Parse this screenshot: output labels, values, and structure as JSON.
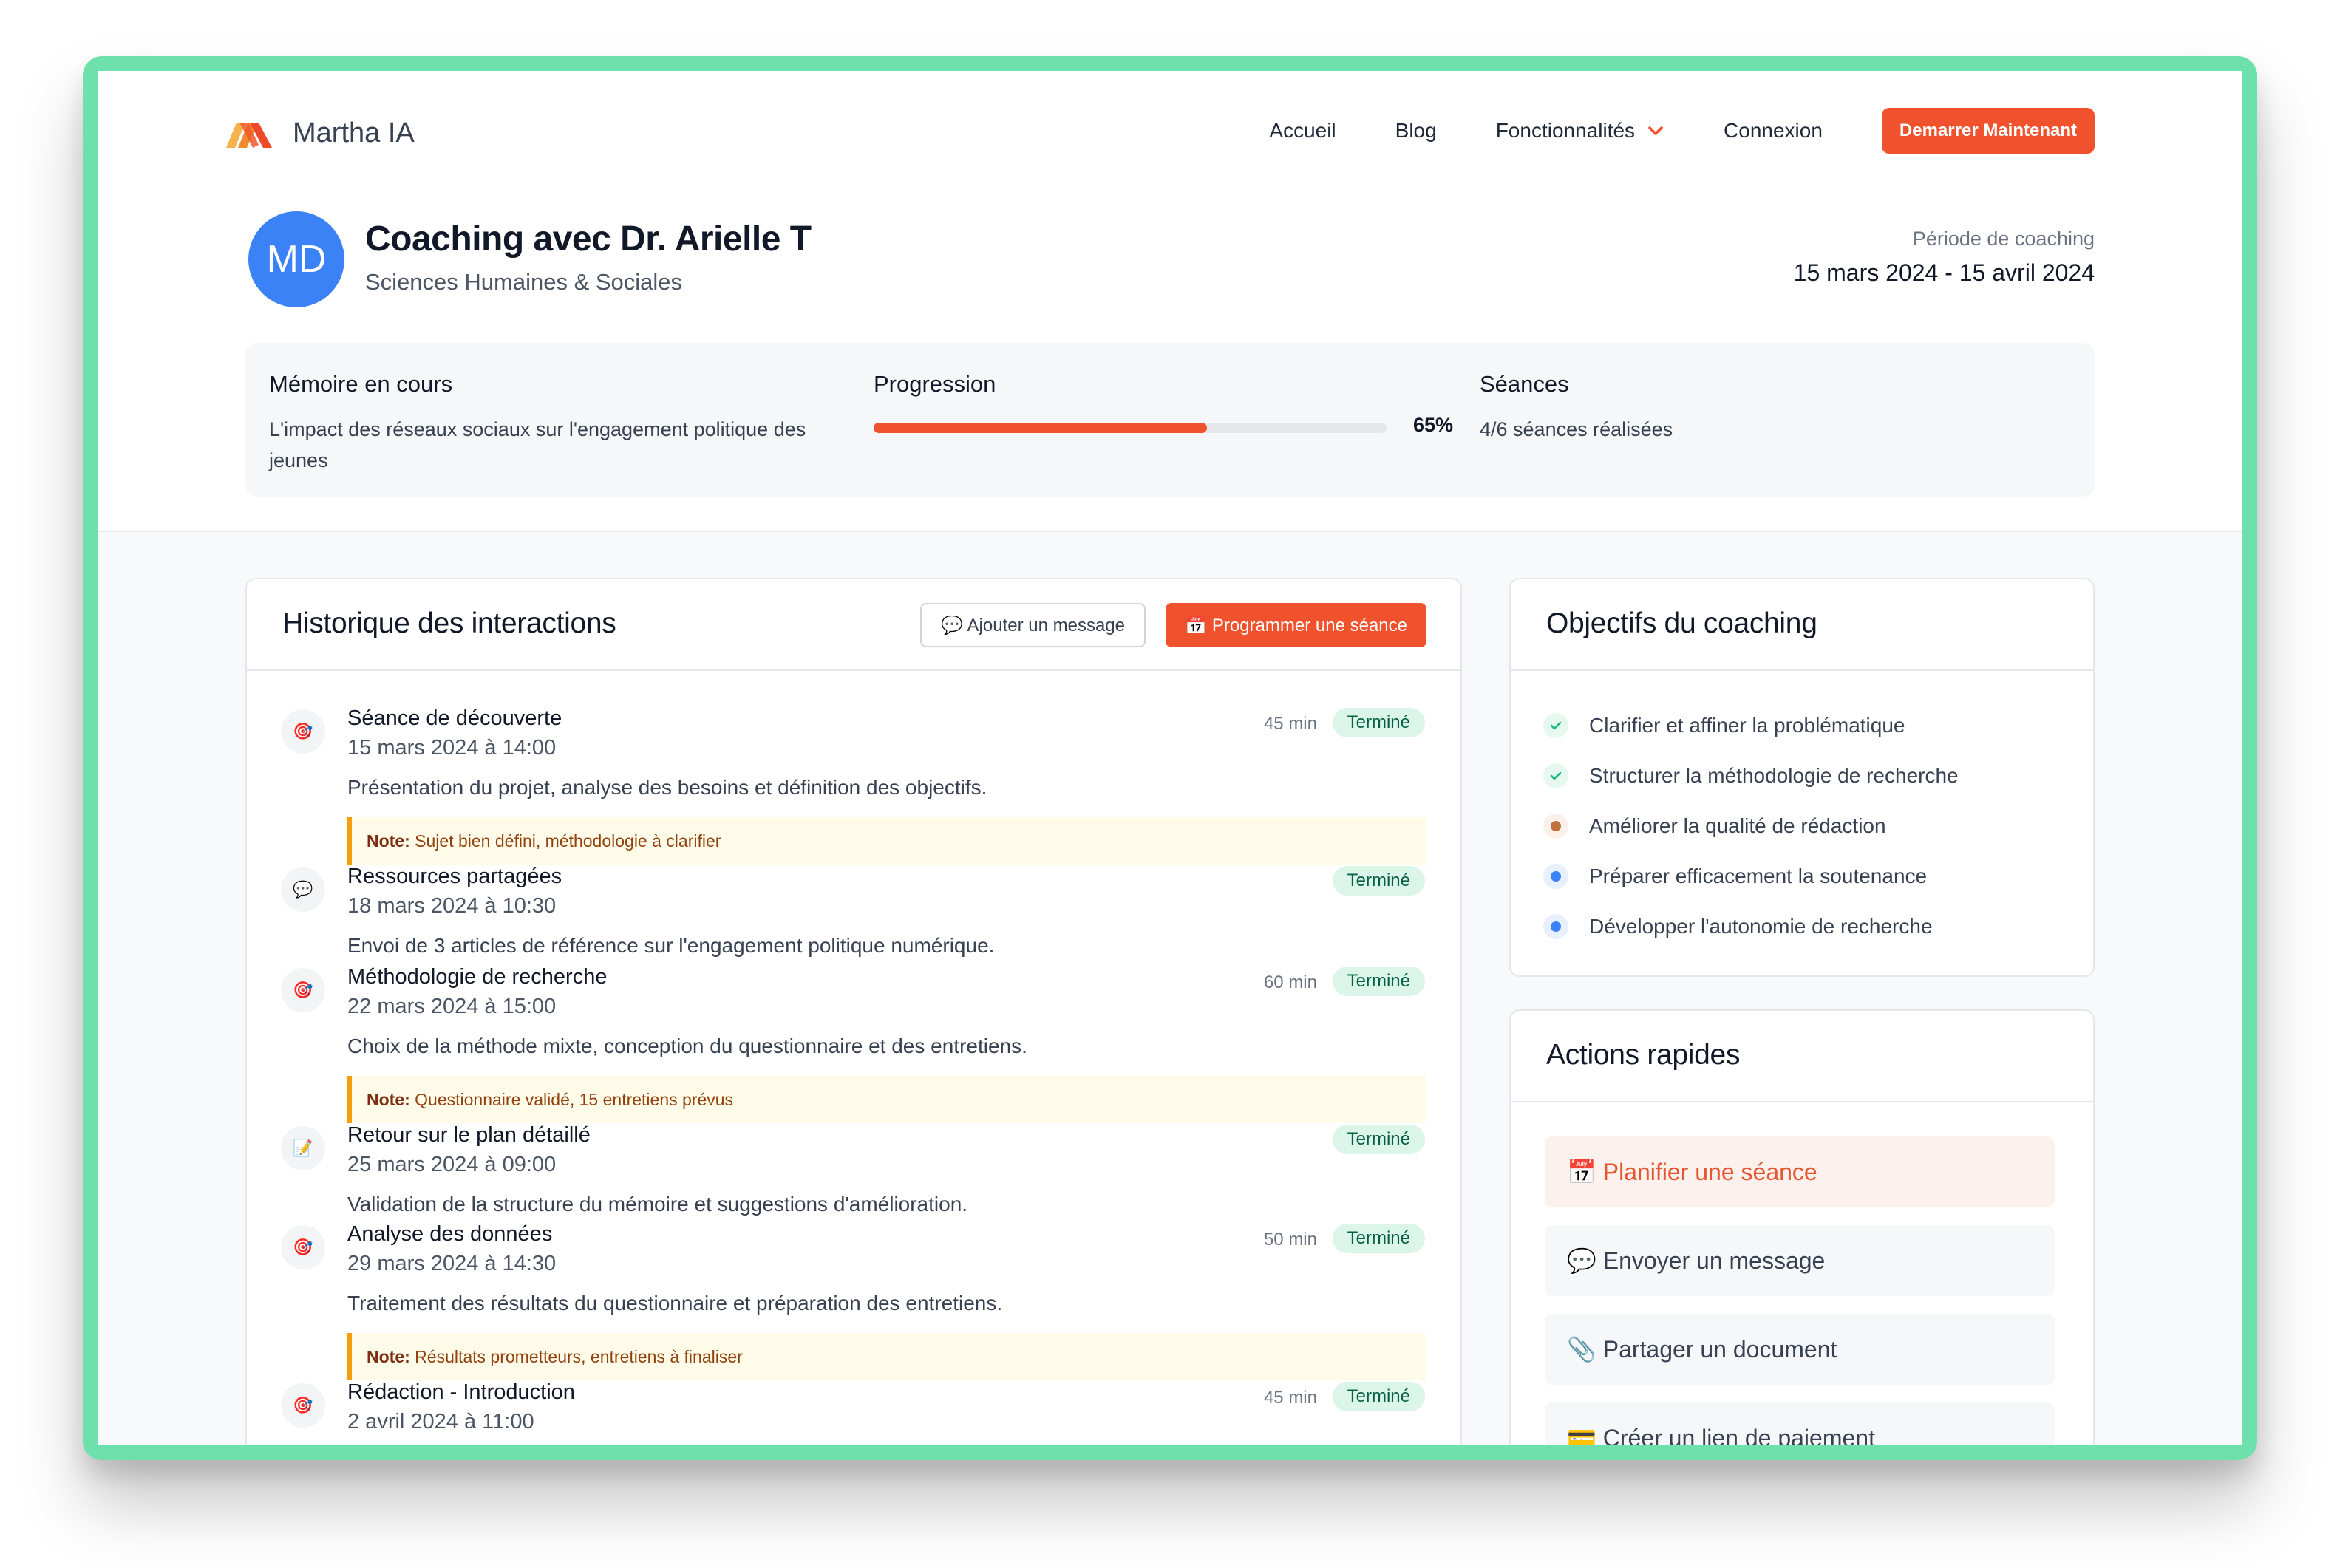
{
  "nav": {
    "brand": "Martha IA",
    "links": [
      "Accueil",
      "Blog",
      "Fonctionnalités",
      "Connexion"
    ],
    "cta": "Demarrer Maintenant"
  },
  "coach": {
    "initials": "MD",
    "title": "Coaching avec Dr. Arielle T",
    "subtitle": "Sciences Humaines & Sociales",
    "period_label": "Période de coaching",
    "period_value": "15 mars 2024 - 15 avril 2024"
  },
  "summary": {
    "thesis_title": "Mémoire en cours",
    "thesis_text": "L'impact des réseaux sociaux sur l'engagement politique des jeunes",
    "progress_title": "Progression",
    "progress_value": 0.65,
    "progress_label": "65%",
    "sessions_title": "Séances",
    "sessions_text": "4/6 séances réalisées"
  },
  "history": {
    "title": "Historique des interactions",
    "add_message": "💬 Ajouter un message",
    "schedule": "📅 Programmer une séance",
    "note_label": "Note:",
    "entries": [
      {
        "icon": "🎯",
        "title": "Séance de découverte",
        "date": "15 mars 2024 à 14:00",
        "duration": "45 min",
        "status": "Terminé",
        "desc": "Présentation du projet, analyse des besoins et définition des objectifs.",
        "note": "Sujet bien défini, méthodologie à clarifier"
      },
      {
        "icon": "💬",
        "title": "Ressources partagées",
        "date": "18 mars 2024 à 10:30",
        "duration": "",
        "status": "Terminé",
        "desc": "Envoi de 3 articles de référence sur l'engagement politique numérique.",
        "note": ""
      },
      {
        "icon": "🎯",
        "title": "Méthodologie de recherche",
        "date": "22 mars 2024 à 15:00",
        "duration": "60 min",
        "status": "Terminé",
        "desc": "Choix de la méthode mixte, conception du questionnaire et des entretiens.",
        "note": "Questionnaire validé, 15 entretiens prévus"
      },
      {
        "icon": "📝",
        "title": "Retour sur le plan détaillé",
        "date": "25 mars 2024 à 09:00",
        "duration": "",
        "status": "Terminé",
        "desc": "Validation de la structure du mémoire et suggestions d'amélioration.",
        "note": ""
      },
      {
        "icon": "🎯",
        "title": "Analyse des données",
        "date": "29 mars 2024 à 14:30",
        "duration": "50 min",
        "status": "Terminé",
        "desc": "Traitement des résultats du questionnaire et préparation des entretiens.",
        "note": "Résultats prometteurs, entretiens à finaliser"
      },
      {
        "icon": "🎯",
        "title": "Rédaction - Introduction",
        "date": "2 avril 2024 à 11:00",
        "duration": "45 min",
        "status": "Terminé",
        "desc": "",
        "note": ""
      }
    ]
  },
  "objectives": {
    "title": "Objectifs du coaching",
    "items": [
      {
        "text": "Clarifier et affiner la problématique",
        "state": "done"
      },
      {
        "text": "Structurer la méthodologie de recherche",
        "state": "done"
      },
      {
        "text": "Améliorer la qualité de rédaction",
        "state": "in-progress"
      },
      {
        "text": "Préparer efficacement la soutenance",
        "state": "todo"
      },
      {
        "text": "Développer l'autonomie de recherche",
        "state": "todo"
      }
    ],
    "colors": {
      "done": "#10b981",
      "in-progress": "#c2703d",
      "todo": "#3b82f6"
    }
  },
  "quick_actions": {
    "title": "Actions rapides",
    "items": [
      "📅 Planifier une séance",
      "💬 Envoyer un message",
      "📎 Partager un document",
      "💳 Créer un lien de paiement"
    ]
  },
  "colors": {
    "accent": "#f0522d",
    "frame": "#6ee0ab",
    "avatar": "#3b82f6"
  }
}
